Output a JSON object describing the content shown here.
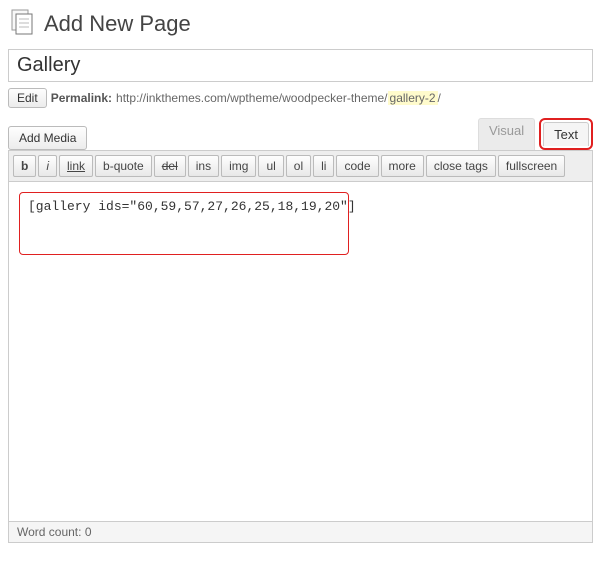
{
  "header": {
    "title": "Add New Page"
  },
  "title_input": {
    "value": "Gallery"
  },
  "permalink": {
    "edit_label": "Edit",
    "label": "Permalink:",
    "url_prefix": "http://inkthemes.com/wptheme/woodpecker-theme/",
    "slug": "gallery-2",
    "url_suffix": "/"
  },
  "media": {
    "add_media_label": "Add Media"
  },
  "tabs": {
    "visual": "Visual",
    "text": "Text"
  },
  "toolbar": {
    "b": "b",
    "i": "i",
    "link": "link",
    "bquote": "b-quote",
    "del": "del",
    "ins": "ins",
    "img": "img",
    "ul": "ul",
    "ol": "ol",
    "li": "li",
    "code": "code",
    "more": "more",
    "close": "close tags",
    "fullscreen": "fullscreen"
  },
  "editor": {
    "content": "[gallery ids=\"60,59,57,27,26,25,18,19,20\"]"
  },
  "status": {
    "wordcount_label": "Word count:",
    "wordcount_value": "0"
  }
}
